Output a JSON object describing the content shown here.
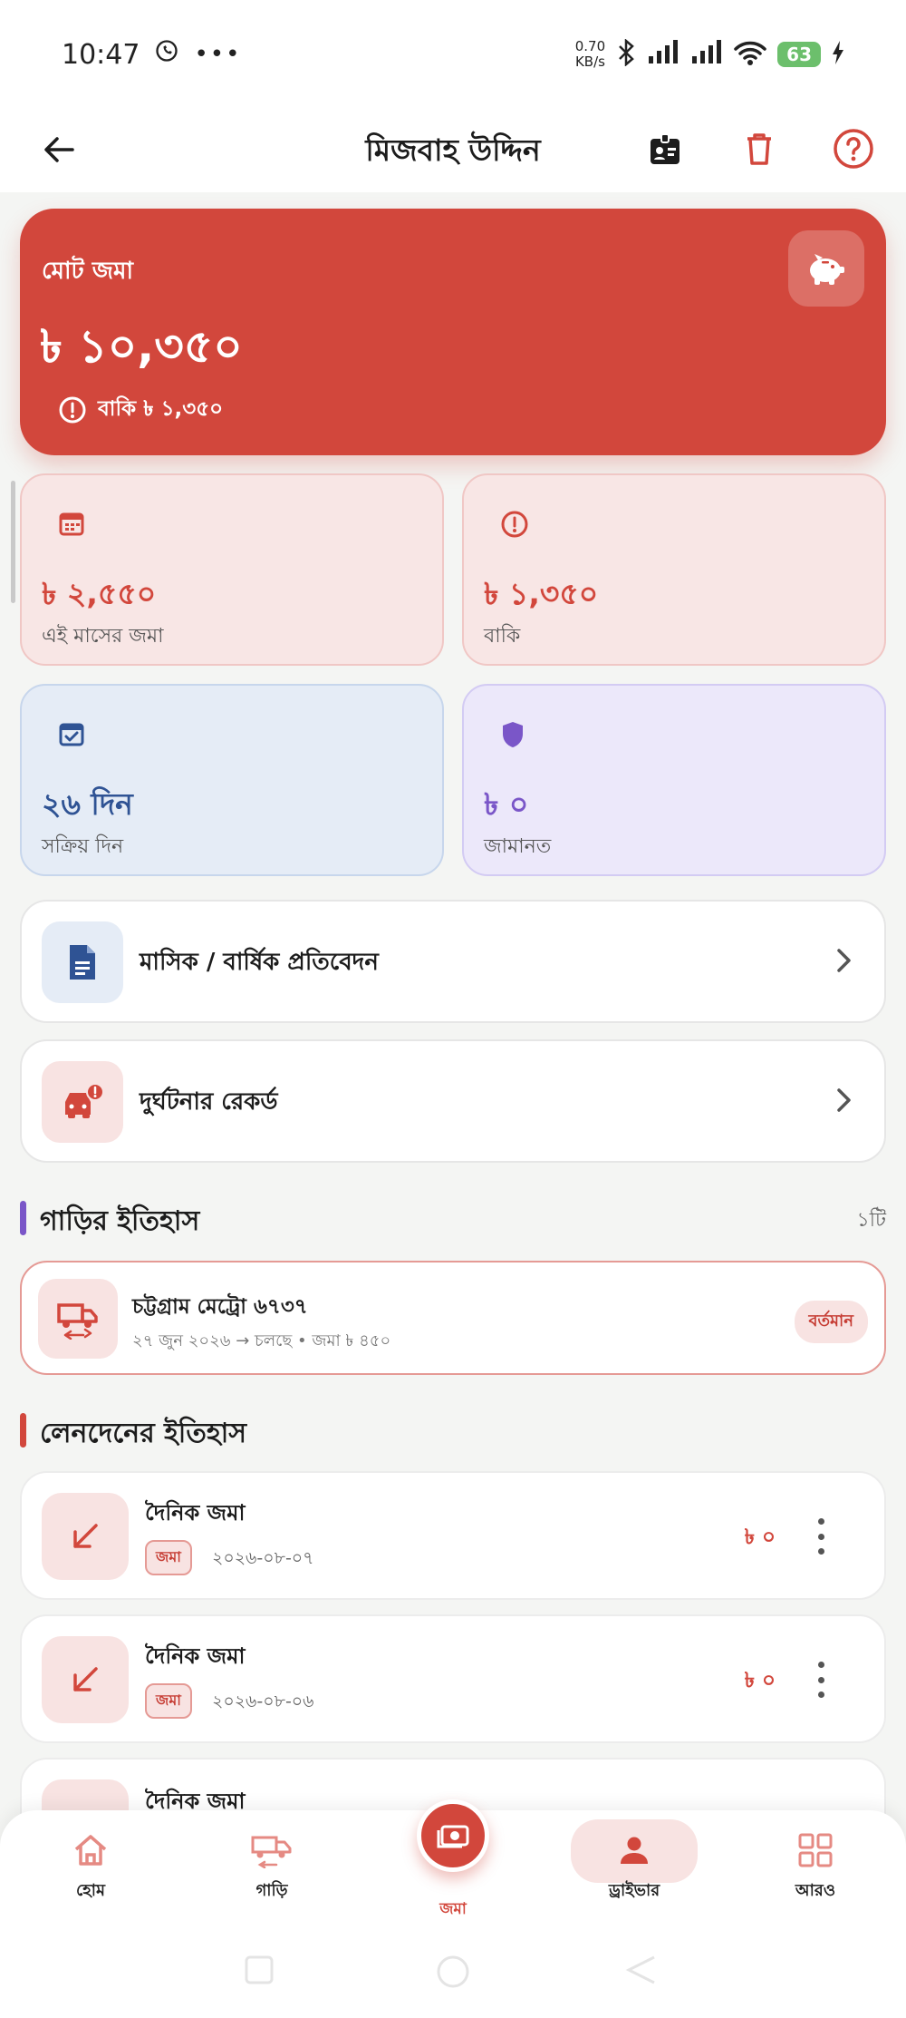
{
  "status_bar": {
    "time": "10:47",
    "net_speed_value": "0.70",
    "net_speed_unit": "KB/s",
    "battery": "63"
  },
  "header": {
    "title": "মিজবাহ উদ্দিন"
  },
  "summary": {
    "total_label": "মোট জমা",
    "total_amount": "৳ ১০,৩৫০",
    "due_text": "বাকি ৳ ১,৩৫০"
  },
  "stats": [
    {
      "value": "৳ ২,৫৫০",
      "label": "এই মাসের জমা",
      "icon": "calendar-icon"
    },
    {
      "value": "৳ ১,৩৫০",
      "label": "বাকি",
      "icon": "alert-icon"
    },
    {
      "value": "২৬ দিন",
      "label": "সক্রিয় দিন",
      "icon": "calendar-check-icon"
    },
    {
      "value": "৳ ০",
      "label": "জামানত",
      "icon": "shield-icon"
    }
  ],
  "menu": [
    {
      "label": "মাসিক / বার্ষিক প্রতিবেদন",
      "icon": "document-icon"
    },
    {
      "label": "দুর্ঘটনার রেকর্ড",
      "icon": "car-crash-icon"
    }
  ],
  "vehicle_history": {
    "title": "গাড়ির ইতিহাস",
    "count": "১টি",
    "items": [
      {
        "name": "চট্টগ্রাম মেট্রো ৬৭৩৭",
        "meta": "২৭ জুন ২০২৬ → চলছে • জমা ৳ ৪৫০",
        "badge": "বর্তমান"
      }
    ]
  },
  "transactions": {
    "title": "লেনদেনের ইতিহাস",
    "items": [
      {
        "title": "দৈনিক জমা",
        "tag": "জমা",
        "date": "২০২৬-০৮-০৭",
        "amount": "৳ ০"
      },
      {
        "title": "দৈনিক জমা",
        "tag": "জমা",
        "date": "২০২৬-০৮-০৬",
        "amount": "৳ ০"
      },
      {
        "title": "দৈনিক জমা"
      }
    ]
  },
  "bottom_nav": {
    "items": [
      {
        "label": "হোম",
        "icon": "home-icon"
      },
      {
        "label": "গাড়ি",
        "icon": "vehicle-icon"
      },
      {
        "label": "জমা",
        "icon": "cash-icon"
      },
      {
        "label": "ড্রাইভার",
        "icon": "person-icon"
      },
      {
        "label": "আরও",
        "icon": "grid-icon"
      }
    ],
    "active": "ড্রাইভার"
  },
  "colors": {
    "primary": "#d2473c",
    "blue": "#2f5394",
    "violet": "#7a56c8"
  }
}
